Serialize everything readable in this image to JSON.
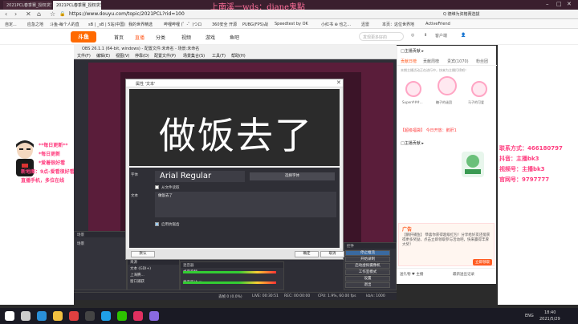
{
  "browser": {
    "tabs": [
      {
        "label": "2021PCL春季赛_授权求生..."
      },
      {
        "label": "2021PCL春季赛_授权求生直播间"
      }
    ],
    "overlay_title": "上南溪一wds：diane鬼點",
    "url": "https://www.douyu.com/topic/2021PCL?rid=100",
    "addr_right": "Q  德维为资格赛选拔",
    "bookmarks": [
      "自定...",
      "应急之地",
      "斗鱼-每个人的直",
      "sB | _sB | 5站(中国)",
      "我的世界精选",
      "哔哩哔哩 (゜-゜)つロ",
      "360安全 开源",
      "PUBG(FPS)战",
      "Speedtest by OK",
      "小红书 ⊕ 也之...",
      "迅雷",
      "本页：这位世界地",
      "ActiveFriend"
    ]
  },
  "site": {
    "logo": "斗鱼",
    "nav": [
      "首页",
      "直播",
      "分类",
      "视频",
      "游戏",
      "鱼吧"
    ],
    "active_nav": 1,
    "search_placeholder": "发现更多好的",
    "header_right": [
      "◎",
      "⬇",
      "客户端",
      "👤"
    ]
  },
  "overlays": {
    "left": [
      "**每日更新**",
      "*每日更新",
      "*爱着很好看"
    ],
    "left2": [
      "新地图：9点-爱看很好看",
      "直播手机，多位在线"
    ],
    "right": [
      "联系方式：466180797",
      "抖音：主播bk3",
      "视频号：主播bk3",
      "官网号：9797777"
    ]
  },
  "panel": {
    "top": "□主播贡献 ▸",
    "tabs": [
      "贡献日榜",
      "贡献周榜",
      "贵宾(1070)",
      "粉丝团"
    ],
    "notice": "本期主播活动正在进行中，快来为主播打榜吧！",
    "ranks": [
      {
        "name": "Super###..."
      },
      {
        "name": "糖子的谜团"
      },
      {
        "name": "马子的可爱"
      }
    ],
    "messages": [
      "【超级福袋】 今日开放：鹅肝1",
      "□主播贡献 ▸"
    ],
    "ad_title": "广告",
    "ad_text": "【鹅肝捕鱼】 恭喜你获得超级红包！分享给好友还能获得更多奖励，点击立即领取参与活动吧，快来赢得丰厚大奖！",
    "ad_button": "立即领取",
    "gift_left": "送礼物 ♥ 主播",
    "gift_right": "最新送出记录"
  },
  "obs": {
    "title": "OBS 26.1.1 (64-bit, windows) - 配置文件:未命名 - 场景:未命名",
    "menu": [
      "文件(F)",
      "编辑(E)",
      "视图(V)",
      "停靠(D)",
      "配置文件(P)",
      "场景集合(S)",
      "工具(T)",
      "帮助(H)"
    ],
    "dialog": {
      "title": "属性 '文本'",
      "preview_text": "做饭去了",
      "font_label": "字体",
      "font_value": "Arial Regular",
      "font_button": "选择字体",
      "from_file": "从文件读取",
      "text_label": "文本",
      "text_value": "做饭去了",
      "antialias": "启用抗锯齿",
      "defaults": "默认",
      "ok": "确定",
      "cancel": "取消"
    },
    "scenes_head": "场景",
    "scenes": [
      "场景"
    ],
    "sources_head": "来源",
    "sources": [
      "文本 (GDI+)",
      "上海腾...",
      "窗口捕获"
    ],
    "mixer_head": "混音器",
    "mixer": [
      "桌面音频",
      "麦克风/Aux"
    ],
    "controls_head": "控件",
    "controls": [
      "停止推流",
      "开始录制",
      "启动虚拟摄像机",
      "工作室模式",
      "设置",
      "退出"
    ],
    "status": [
      "丢帧 0 (0.0%)",
      "LIVE: 00:30:51",
      "REC: 00:00:00",
      "CPU: 1.9%, 60.00 fps",
      "kb/s: 1000"
    ]
  },
  "taskbar": {
    "time": "18:40",
    "date": "2021/5/29",
    "lang": "ENG",
    "icons": [
      {
        "name": "windows-icon",
        "color": "#ffffff"
      },
      {
        "name": "search-icon",
        "color": "#cccccc"
      },
      {
        "name": "edge-icon",
        "color": "#2a8fd8"
      },
      {
        "name": "folder-icon",
        "color": "#f2c040"
      },
      {
        "name": "chrome-icon",
        "color": "#e04040"
      },
      {
        "name": "obs-icon",
        "color": "#444444"
      },
      {
        "name": "qq-icon",
        "color": "#1fa0e8"
      },
      {
        "name": "wechat-icon",
        "color": "#2dc100"
      },
      {
        "name": "music-icon",
        "color": "#e03060"
      },
      {
        "name": "game-icon",
        "color": "#8a6ae0"
      }
    ]
  },
  "colors": {
    "accent": "#ff5d23",
    "overlay_pink": "#ff3d7f",
    "obs_dark": "#2e2e36"
  }
}
